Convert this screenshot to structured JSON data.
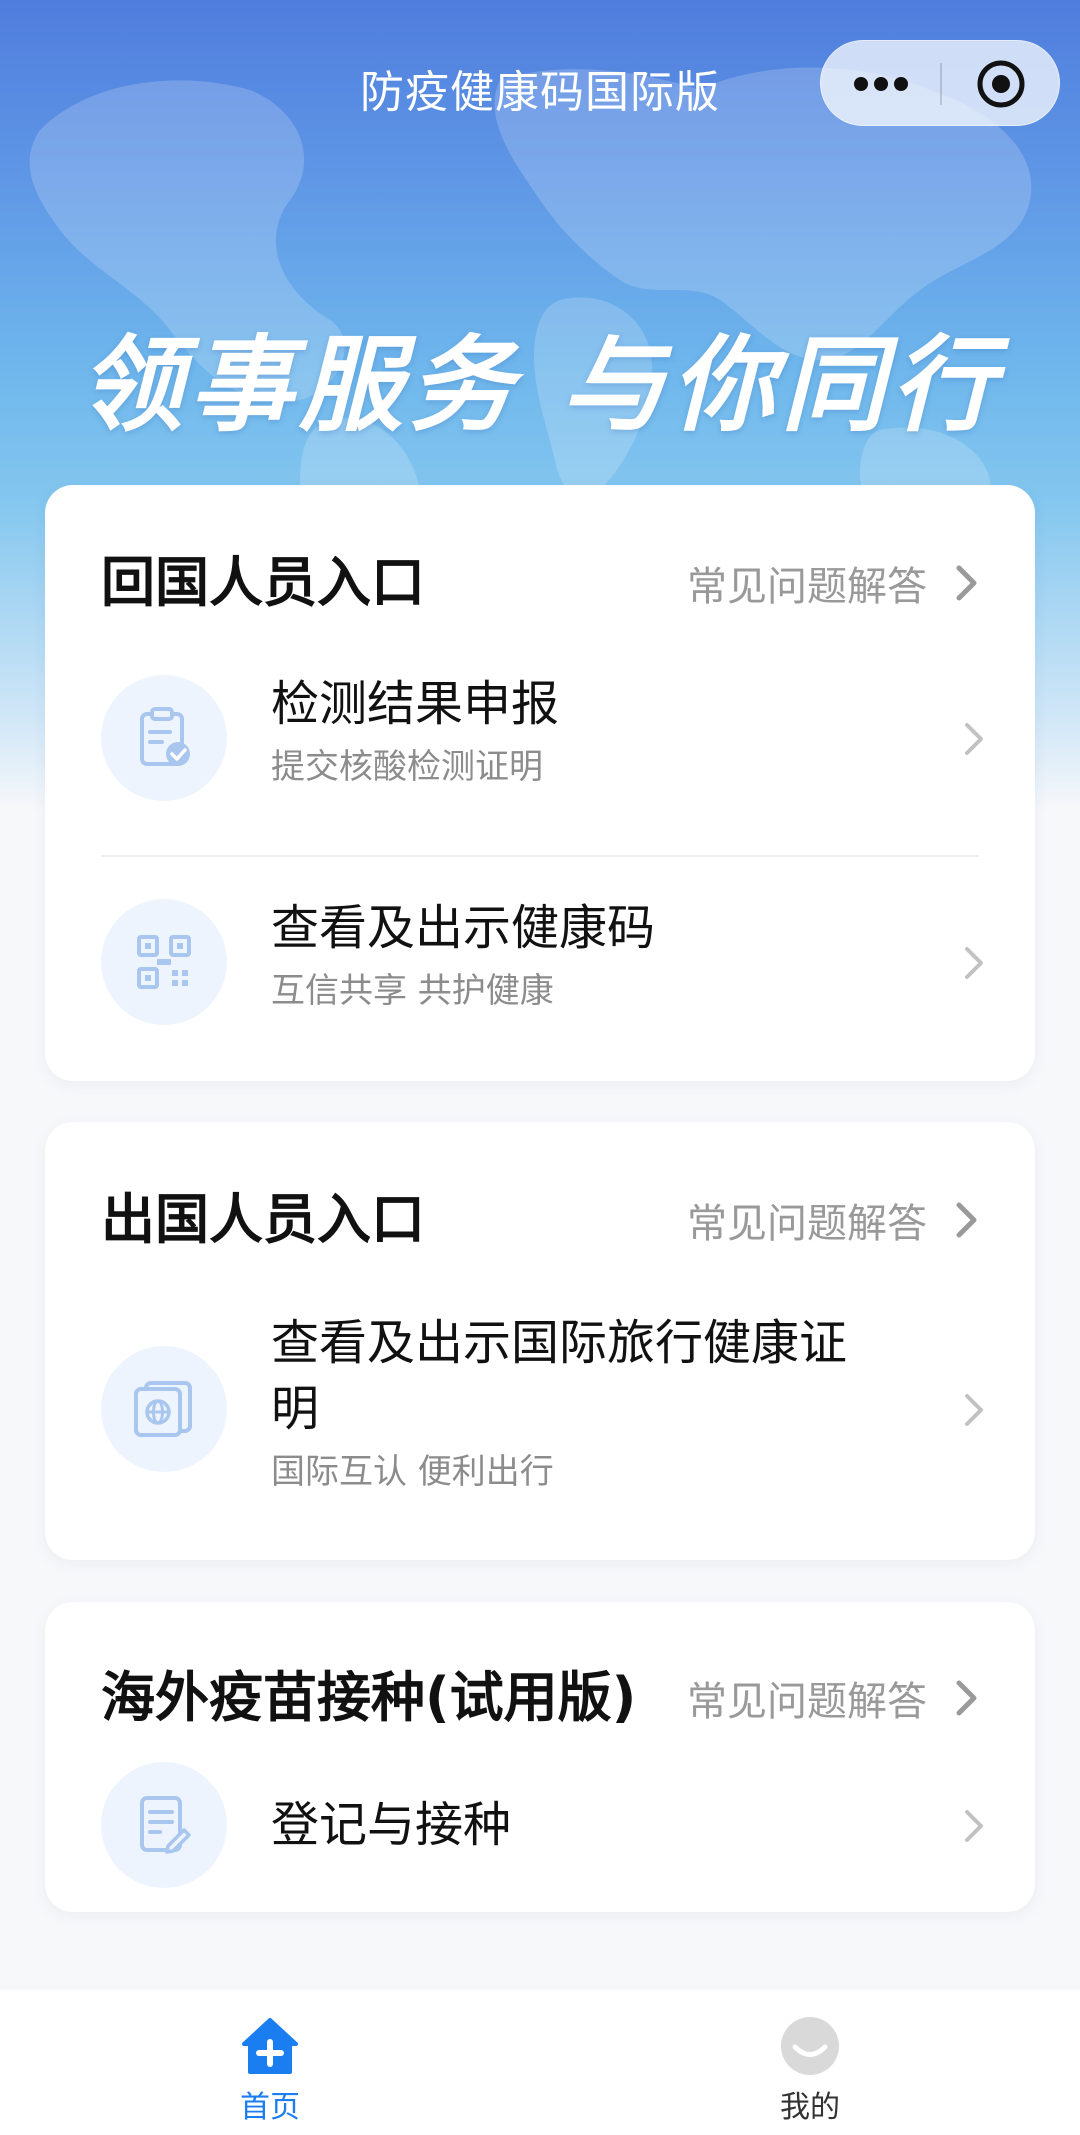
{
  "header": {
    "title": "防疫健康码国际版",
    "slogan": "领事服务 与你同行"
  },
  "sections": [
    {
      "title": "回国人员入口",
      "faq": "常见问题解答",
      "items": [
        {
          "title": "检测结果申报",
          "subtitle": "提交核酸检测证明",
          "icon": "clipboard-check-icon"
        },
        {
          "title": "查看及出示健康码",
          "subtitle": "互信共享 共护健康",
          "icon": "qr-code-icon"
        }
      ]
    },
    {
      "title": "出国人员入口",
      "faq": "常见问题解答",
      "items": [
        {
          "title_line1": "查看及出示国际旅行健康证",
          "title_line2": "明",
          "subtitle": "国际互认 便利出行",
          "icon": "passport-icon"
        }
      ]
    },
    {
      "title": "海外疫苗接种(试用版)",
      "faq": "常见问题解答",
      "items": [
        {
          "title": "登记与接种",
          "icon": "register-doc-icon"
        }
      ]
    }
  ],
  "tabbar": {
    "items": [
      {
        "label": "首页",
        "icon": "home-icon",
        "active": true
      },
      {
        "label": "我的",
        "icon": "profile-icon",
        "active": false
      }
    ]
  },
  "colors": {
    "accent": "#1a7df0",
    "icon_bg": "#eef4fd",
    "icon_stroke": "#a9c6ef",
    "muted": "#999999"
  }
}
